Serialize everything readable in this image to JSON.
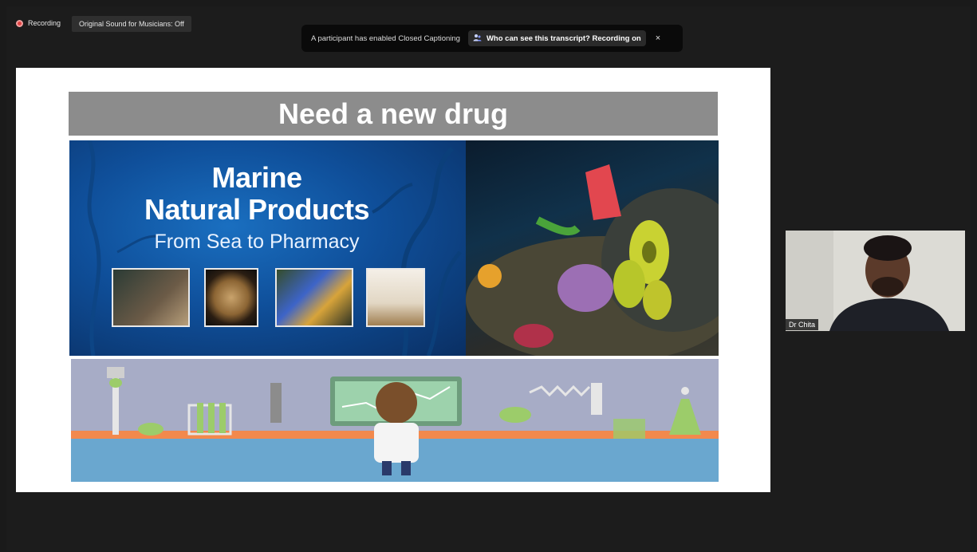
{
  "recording": {
    "label": "Recording",
    "status_color": "#e04343"
  },
  "original_sound": {
    "label": "Original Sound for Musicians: Off"
  },
  "caption_banner": {
    "message": "A participant has enabled Closed Captioning",
    "button_label": "Who can see this transcript? Recording on",
    "button_icon": "people-icon",
    "close_icon": "close-icon",
    "close_glyph": "×"
  },
  "slide": {
    "title": "Need a new drug",
    "marine_title_line1": "Marine",
    "marine_title_line2": "Natural Products",
    "marine_subtitle": "From Sea to Pharmacy"
  },
  "participant": {
    "name": "Dr Chita"
  },
  "colors": {
    "title_bar": "#8c8c8c",
    "marine_blue": "#0f4f9a",
    "lab_background": "#a7acc6"
  }
}
